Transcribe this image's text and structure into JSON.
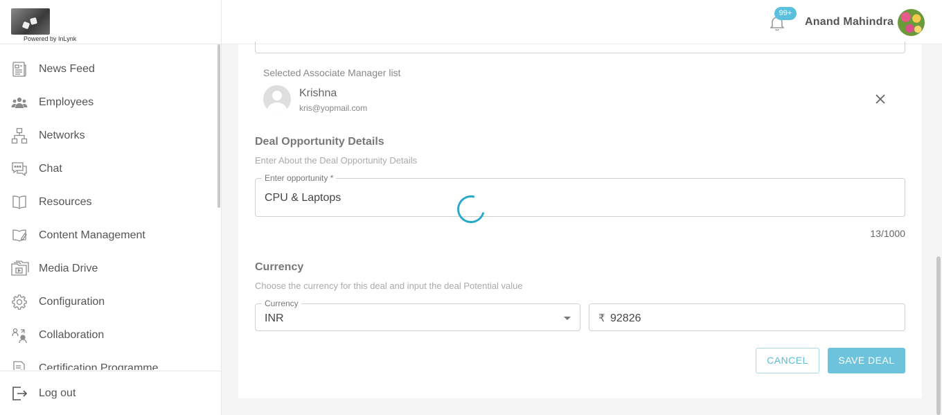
{
  "brand": {
    "powered_by": "Powered by InLynk"
  },
  "sidebar": {
    "items": [
      {
        "label": "News Feed",
        "icon": "news-feed-icon"
      },
      {
        "label": "Employees",
        "icon": "employees-icon"
      },
      {
        "label": "Networks",
        "icon": "networks-icon"
      },
      {
        "label": "Chat",
        "icon": "chat-icon"
      },
      {
        "label": "Resources",
        "icon": "book-icon"
      },
      {
        "label": "Content Management",
        "icon": "content-management-icon"
      },
      {
        "label": "Media Drive",
        "icon": "media-drive-icon"
      },
      {
        "label": "Configuration",
        "icon": "gear-icon"
      },
      {
        "label": "Collaboration",
        "icon": "collaboration-icon"
      },
      {
        "label": "Certification Programme",
        "icon": "certificate-icon"
      }
    ],
    "logout": "Log out"
  },
  "header": {
    "notification_badge": "99+",
    "user_name": "Anand Mahindra"
  },
  "form": {
    "selected_heading": "Selected Associate Manager list",
    "manager": {
      "name": "Krishna",
      "email": "kris@yopmail.com"
    },
    "deal_section": {
      "title": "Deal Opportunity Details",
      "subtitle": "Enter About the Deal Opportunity Details",
      "opportunity_label": "Enter opportunity *",
      "opportunity_value": "CPU & Laptops",
      "counter": "13/1000"
    },
    "currency_section": {
      "title": "Currency",
      "subtitle": "Choose the currency for this deal and input the deal Potential value",
      "currency_label": "Currency",
      "currency_value": "INR",
      "rupee_symbol": "₹",
      "amount_value": "92826"
    },
    "buttons": {
      "cancel": "CANCEL",
      "save": "SAVE DEAL"
    }
  },
  "colors": {
    "accent": "#5bc0de",
    "save_button": "#6cc3db",
    "spinner": "#2aa8c7"
  }
}
